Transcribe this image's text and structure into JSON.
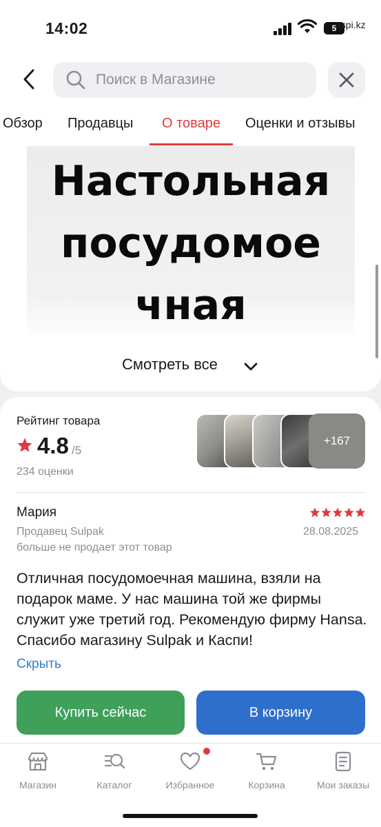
{
  "status_bar": {
    "time": "14:02",
    "battery": "5",
    "watermark": "aspi.kz"
  },
  "header": {
    "back_icon": "chevron-left-icon",
    "search_placeholder": "Поиск в Магазине",
    "close_icon": "close-icon"
  },
  "tabs": [
    {
      "label": "Обзор",
      "active": false
    },
    {
      "label": "Продавцы",
      "active": false
    },
    {
      "label": "О товаре",
      "active": true
    },
    {
      "label": "Оценки и отзывы",
      "active": false
    }
  ],
  "description": {
    "image_text": [
      "Настольная",
      "посудомое",
      "чная"
    ],
    "see_all": "Смотреть все"
  },
  "rating": {
    "label": "Рейтинг товара",
    "value": "4.8",
    "max": "/5",
    "count": "234 оценки",
    "more_photos": "+167",
    "star_color": "#e0393e"
  },
  "review": {
    "author": "Мария",
    "stars": 5,
    "seller": "Продавец Sulpak",
    "date": "28.08.2025",
    "seller_note": "больше не продает этот товар",
    "text": "Отличная посудомоечная машина, взяли на подарок маме. У нас машина той же фирмы служит уже третий год. Рекомендую фирму Hansa. Спасибо магазину Sulpak и Каспи!",
    "hide": "Скрыть"
  },
  "actions": {
    "buy_now": "Купить сейчас",
    "add_to_cart": "В корзину",
    "buy_color": "#3fa05a",
    "cart_color": "#2f6fcc"
  },
  "bottom_nav": [
    {
      "label": "Магазин",
      "icon": "store-icon"
    },
    {
      "label": "Каталог",
      "icon": "catalog-icon"
    },
    {
      "label": "Избранное",
      "icon": "heart-icon",
      "badge": true
    },
    {
      "label": "Корзина",
      "icon": "cart-icon"
    },
    {
      "label": "Мои заказы",
      "icon": "orders-icon"
    }
  ],
  "colors": {
    "accent": "#e0393e",
    "link": "#2e7cd6"
  }
}
